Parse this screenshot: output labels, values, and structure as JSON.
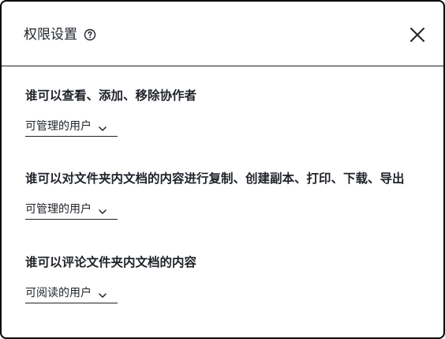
{
  "dialog": {
    "title": "权限设置",
    "help_icon": "question-circle-icon",
    "close_icon": "close-icon"
  },
  "sections": [
    {
      "label": "谁可以查看、添加、移除协作者",
      "selected": "可管理的用户"
    },
    {
      "label": "谁可以对文件夹内文档的内容进行复制、创建副本、打印、下载、导出",
      "selected": "可管理的用户"
    },
    {
      "label": "谁可以评论文件夹内文档的内容",
      "selected": "可阅读的用户"
    }
  ],
  "colors": {
    "text": "#1f2329",
    "border": "#000000",
    "background": "#ffffff"
  }
}
